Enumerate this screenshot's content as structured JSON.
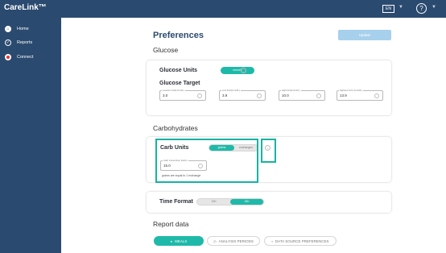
{
  "app": {
    "brand": "CareLink™",
    "language": "EN"
  },
  "sidebar": {
    "items": [
      {
        "label": "Home"
      },
      {
        "label": "Reports"
      },
      {
        "label": "Connect"
      }
    ]
  },
  "page": {
    "title": "Preferences",
    "update_label": "Update"
  },
  "glucose": {
    "heading": "Glucose",
    "units_label": "Glucose Units",
    "units_value": "mmol/L",
    "target_label": "Glucose Target",
    "fields": [
      {
        "label": "Lowest Limit(mmol/L)",
        "value": "3.0"
      },
      {
        "label": "Low limit(mmol/L)",
        "value": "3.9"
      },
      {
        "label": "High limit(mmol/L)",
        "value": "10.0"
      },
      {
        "label": "Highest Limit (mmol/L)",
        "value": "13.9"
      }
    ]
  },
  "carbs": {
    "heading": "Carbohydrates",
    "units_label": "Carb Units",
    "option_grams": "grams",
    "option_exchanges": "exchanges",
    "selected": "grams",
    "conversion_label": "Carb Conversion Factor",
    "conversion_value": "15.0",
    "note": "grams are equal to 1 exchange"
  },
  "time": {
    "label": "Time Format",
    "option_12": "12h",
    "option_24": "24h",
    "selected": "24h"
  },
  "report": {
    "heading": "Report data",
    "tabs": [
      {
        "label": "MEALS",
        "active": true
      },
      {
        "label": "ANALYSIS PERIODS",
        "active": false
      },
      {
        "label": "DATA SOURCE PREFERENCES",
        "active": false
      }
    ]
  },
  "colors": {
    "nav_bg": "#2b4a6f",
    "accent": "#1fb9a9",
    "highlight": "#17b3a3",
    "update_button": "#a6d0ec"
  }
}
